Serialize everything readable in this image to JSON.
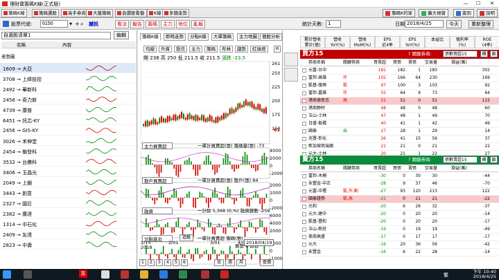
{
  "window": {
    "title": "理財寶籌碼K線(正式版)",
    "minimize": "—",
    "maximize": "☐",
    "close": "✕"
  },
  "tabs": [
    "籌碼K線",
    "籌碼選股",
    "高手券商",
    "大盤籌碼",
    "自選股看盤",
    "K線",
    "多國走勢"
  ],
  "toolbar": {
    "broker_home": "籌碼K的家",
    "zoom": "擴大視窗",
    "login": "簽到",
    "help": "說明"
  },
  "row2": {
    "stock_code_label": "股票代號:",
    "stock_code_value": "6150",
    "stock_name": "撼訊",
    "quick_buttons": [
      "看法",
      "報告",
      "籌碼",
      "主力",
      "地位",
      "亂報"
    ],
    "period_label": "統計天數:",
    "period_value": "1",
    "date_label": "日期:",
    "date_value": "2018/4/25",
    "today_button": "今天",
    "refresh_button": "重新整理"
  },
  "left": {
    "group_name": "自選股清單1",
    "edit_button": "編輯",
    "header_name": "名稱",
    "header_content": "內容",
    "header_old": "老勢圖",
    "stocks": [
      "1609 → 大亞",
      "3708 → 上緯投控",
      "2492 → 華新科",
      "2456 → 奇力新",
      "4739 → 康普",
      "6451 → 訊芯-KY",
      "2456 → GIS-KY",
      "3026 → 禾伸堂",
      "2454 → 聯發科",
      "3532 → 台勝科",
      "3406 → 玉晶光",
      "2049 → 上銀",
      "3443 → 創意",
      "2327 → 國巨",
      "2382 → 廣達",
      "1314 → 中石化",
      "2409 → 友達",
      "2823 → 中壽"
    ]
  },
  "center": {
    "subtabs": [
      "籌碼K線",
      "即時走勢",
      "分點K線",
      "大單籌碼",
      "主力地圖",
      "個股分析"
    ],
    "tools": [
      "均線",
      "外資",
      "投信",
      "主力",
      "籌碼",
      "布林",
      "趨勢",
      "紅綠燈"
    ],
    "info": {
      "open_label": "開",
      "open": "238",
      "high_label": "高",
      "high": "250",
      "low_label": "低",
      "low": "211.5",
      "close_label": "收",
      "close": "211.5",
      "change_label": "漲跌",
      "change": "-23.5"
    },
    "price_ticks": [
      "261",
      "250",
      "225",
      "200",
      "175",
      "150"
    ],
    "low_marker": "61",
    "panels": [
      {
        "selector": "主力買賣超",
        "caption": "一單計買賣超(張) 籌碼量(張) -73",
        "ticks": [
          "4000",
          "2000",
          "0",
          "-2000"
        ]
      },
      {
        "selector": "散戶買賣超",
        "caption": "一單計買賣超(張) 散戶(張) 84",
        "ticks": [
          "2000",
          "1000",
          "0",
          "-2000"
        ]
      },
      {
        "selector": "融資",
        "caption": "一計餘 5,368 (0,%) 融資變動 -259",
        "ticks": [
          "6000",
          "4000",
          "2000"
        ]
      },
      {
        "selector": "分點進出",
        "caption": "一單計買賣超 籌碼(張)",
        "ticks": [
          "1000",
          "0",
          "-1000"
        ],
        "button": "追蹤"
      }
    ],
    "subcaption": "買張 6 賣張",
    "dates": [
      "1/15\n2018",
      "2/01",
      "3/01",
      "4/02"
    ],
    "tooltip_date": "2018/04/19",
    "nav": [
      "1",
      "2",
      "3",
      "4",
      "5",
      "6"
    ],
    "period_buttons": [
      "日",
      "週",
      "月"
    ],
    "query_button": "查價"
  },
  "right": {
    "columns": [
      {
        "top": "累計營收",
        "bottom": "累計(億)"
      },
      {
        "top": "營收",
        "bottom": "YoY(%)"
      },
      {
        "top": "營收",
        "bottom": "MoM(%)"
      },
      {
        "top": "EPS",
        "bottom": "近4季"
      },
      {
        "top": "EPS",
        "bottom": "YoY(%)"
      },
      {
        "top": "本益比",
        "bottom": ""
      },
      {
        "top": "殖利率",
        "bottom": "(%)"
      },
      {
        "top": "ROE",
        "bottom": "(4季)"
      }
    ],
    "buy": {
      "title": "買方15",
      "question": "?",
      "relation_label": "關鍵券商:",
      "select": "張數買超15",
      "btn1": "欄",
      "btn2": "鎖",
      "headers": [
        "券商名稱",
        "關鍵券商",
        "買賣超",
        "買張",
        "賣張",
        "交易量",
        "損益(萬)"
      ],
      "rows": [
        {
          "name": "元富-台中",
          "key": "",
          "net": "181",
          "buy": "182",
          "sell": "1",
          "vol": "183",
          "pnl": "302"
        },
        {
          "name": "富邦-高雄",
          "key": "作",
          "net": "102",
          "buy": "166",
          "sell": "64",
          "vol": "230",
          "pnl": "169"
        },
        {
          "name": "凱基-復興",
          "key": "凱",
          "net": "97",
          "buy": "100",
          "sell": "3",
          "vol": "103",
          "pnl": "92"
        },
        {
          "name": "富邦-嘉雄",
          "key": "作",
          "net": "55",
          "buy": "64",
          "sell": "9",
          "vol": "73",
          "pnl": "64"
        },
        {
          "name": "港商德意志",
          "key": "高",
          "net": "51",
          "buy": "51",
          "sell": "0",
          "vol": "51",
          "pnl": "115",
          "hl": true
        },
        {
          "name": "港商野村",
          "key": "",
          "net": "48",
          "buy": "48",
          "sell": "0",
          "vol": "48",
          "pnl": "60"
        },
        {
          "name": "玉山-士林",
          "key": "",
          "net": "47",
          "buy": "48",
          "sell": "1",
          "vol": "49",
          "pnl": "70"
        },
        {
          "name": "日盛-板橋",
          "key": "",
          "net": "40",
          "buy": "41",
          "sell": "1",
          "vol": "42",
          "pnl": "49"
        },
        {
          "name": "國泰",
          "key": "出",
          "net": "27",
          "buy": "28",
          "sell": "1",
          "vol": "29",
          "pnl": "14"
        },
        {
          "name": "兆豐-彰化",
          "key": "",
          "net": "26",
          "buy": "41",
          "sell": "15",
          "vol": "56",
          "pnl": "37"
        },
        {
          "name": "新加坡商瑞銀",
          "key": "",
          "net": "21",
          "buy": "21",
          "sell": "0",
          "vol": "21",
          "pnl": "22"
        },
        {
          "name": "元大-士林",
          "key": "",
          "net": "20",
          "buy": "21",
          "sell": "1",
          "vol": "22",
          "pnl": "27"
        }
      ]
    },
    "sell": {
      "title": "賣方15",
      "question": "?",
      "relation_label": "關鍵券商:",
      "select": "張數賣超15",
      "btn1": "欄",
      "btn2": "鎖",
      "headers": [
        "券商名稱",
        "關鍵券商",
        "買賣超",
        "買張",
        "賣張",
        "交易量",
        "損益(萬)"
      ],
      "rows": [
        {
          "name": "富邦-木柵",
          "key": "",
          "net": "-30",
          "buy": "0",
          "sell": "30",
          "vol": "30",
          "pnl": "-44"
        },
        {
          "name": "永豐金-中正",
          "key": "",
          "net": "-28",
          "buy": "9",
          "sell": "37",
          "vol": "46",
          "pnl": "-70"
        },
        {
          "name": "元富-中壢",
          "key": "凱,作,動",
          "net": "-27",
          "buy": "93",
          "sell": "120",
          "vol": "213",
          "pnl": "122"
        },
        {
          "name": "國泰證券",
          "key": "凱,高",
          "net": "-21",
          "buy": "0",
          "sell": "21",
          "vol": "21",
          "pnl": "-22",
          "hl": true
        },
        {
          "name": "光和",
          "key": "",
          "net": "-20",
          "buy": "6",
          "sell": "26",
          "vol": "32",
          "pnl": "-37"
        },
        {
          "name": "元大-建中",
          "key": "",
          "net": "-20",
          "buy": "0",
          "sell": "20",
          "vol": "20",
          "pnl": "-14"
        },
        {
          "name": "凱基-豐和",
          "key": "",
          "net": "-20",
          "buy": "0",
          "sell": "20",
          "vol": "20",
          "pnl": "-17"
        },
        {
          "name": "玉山-新莊",
          "key": "",
          "net": "-19",
          "buy": "0",
          "sell": "19",
          "vol": "19",
          "pnl": "-49"
        },
        {
          "name": "美商高盛",
          "key": "",
          "net": "-17",
          "buy": "0",
          "sell": "17",
          "vol": "17",
          "pnl": "-17"
        },
        {
          "name": "元大",
          "key": "",
          "net": "-16",
          "buy": "20",
          "sell": "36",
          "vol": "56",
          "pnl": "-42"
        },
        {
          "name": "永豐金",
          "key": "",
          "net": "-16",
          "buy": "6",
          "sell": "22",
          "vol": "28",
          "pnl": "-14"
        }
      ]
    }
  },
  "taskbar": {
    "ime": "英",
    "lang": "繁",
    "time": "下午 10:40",
    "date": "2018/4/25"
  },
  "colors": {
    "buy_bar": "#c00000",
    "sell_bar": "#0a8a3a",
    "highlight_row": "#f9c8c8"
  }
}
